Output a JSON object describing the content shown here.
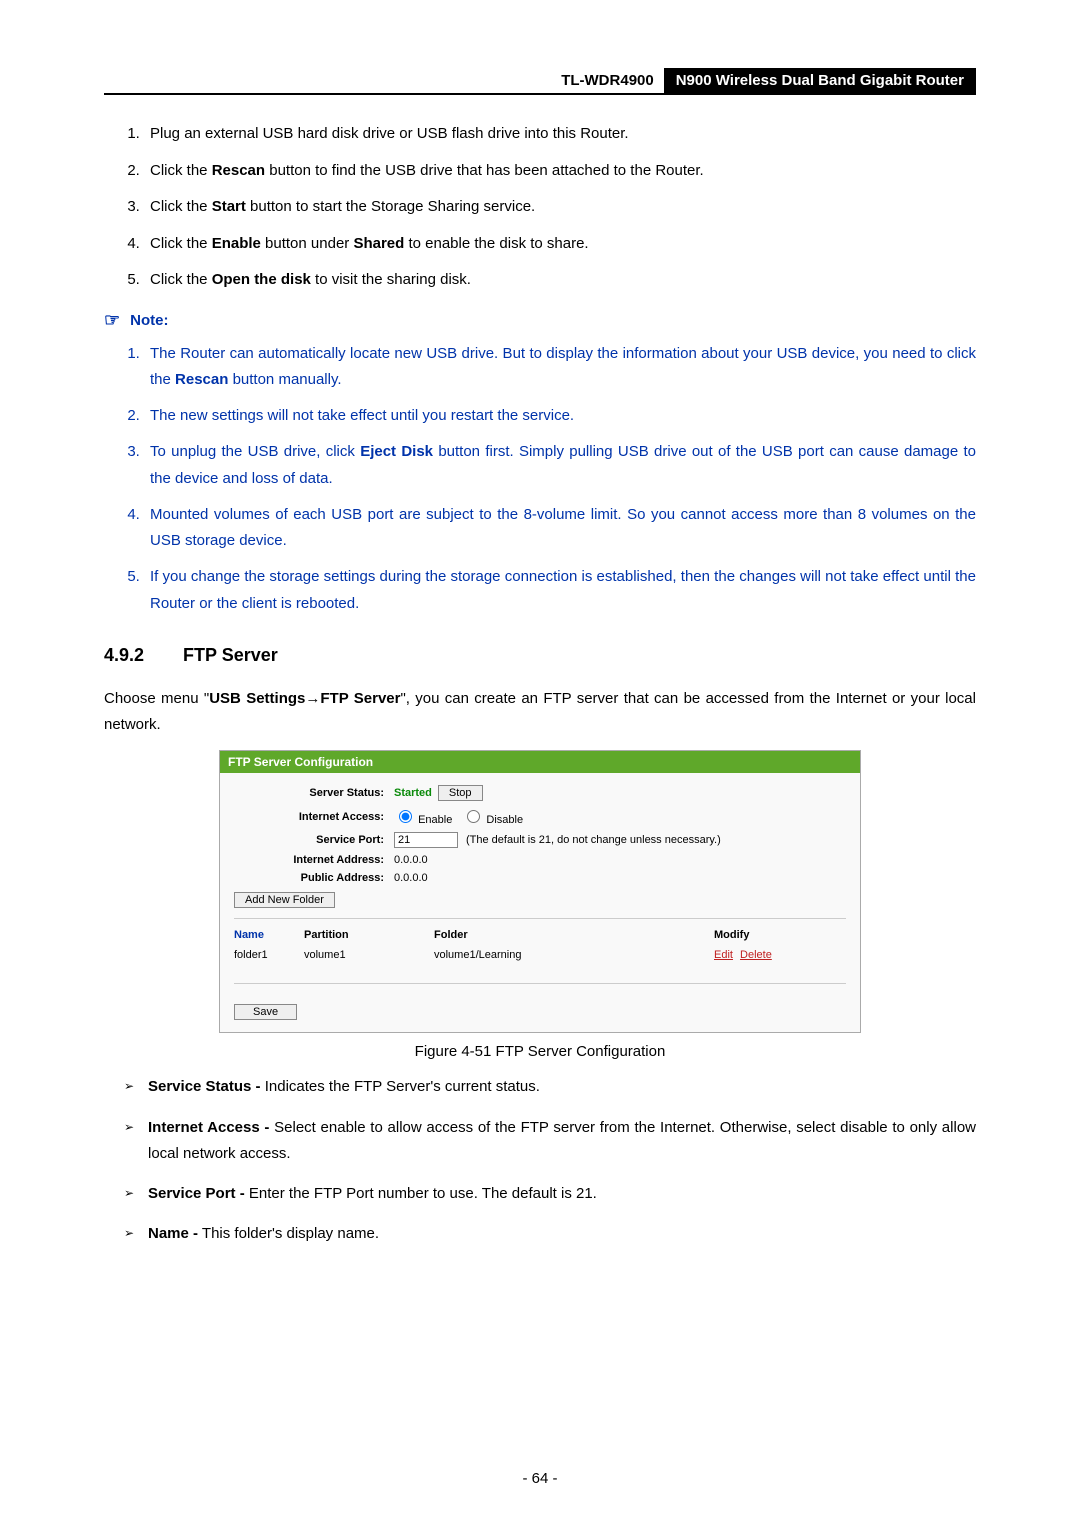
{
  "header": {
    "model": "TL-WDR4900",
    "product": "N900 Wireless Dual Band Gigabit Router"
  },
  "steps": [
    "Plug an external USB hard disk drive or USB flash drive into this Router.",
    "Click the <b>Rescan</b> button to find the USB drive that has been attached to the Router.",
    "Click the <b>Start</b> button to start the Storage Sharing service.",
    "Click the <b>Enable</b> button under <b>Shared</b> to enable the disk to share.",
    "Click the <b>Open the disk</b> to visit the sharing disk."
  ],
  "noteLabel": "Note:",
  "noteItems": [
    "The Router can automatically locate new USB drive. But to display the information about your USB device, you need to click the <b>Rescan</b> button manually.",
    "The new settings will not take effect until you restart the service.",
    "To unplug the USB drive, click <b>Eject Disk</b> button first. Simply pulling USB drive out of the USB port can cause damage to the device and loss of data.",
    "Mounted volumes of each USB port are subject to the 8-volume limit. So you cannot access more than 8 volumes on the USB storage device.",
    "If you change the storage settings during the storage connection is established, then the changes will not take effect until the Router or the client is rebooted."
  ],
  "section": {
    "number": "4.9.2",
    "title": "FTP Server"
  },
  "intro": "Choose menu \"<b>USB Settings</b>→<b>FTP Server</b>\", you can create an FTP server that can be accessed from the Internet or your local network.",
  "ftp": {
    "panelTitle": "FTP Server Configuration",
    "labels": {
      "serverStatus": "Server Status:",
      "internetAccess": "Internet Access:",
      "servicePort": "Service Port:",
      "internetAddress": "Internet Address:",
      "publicAddress": "Public Address:"
    },
    "statusStarted": "Started",
    "stopBtn": "Stop",
    "enableLabel": "Enable",
    "disableLabel": "Disable",
    "servicePortValue": "21",
    "servicePortHint": "(The default is 21, do not change unless necessary.)",
    "internetAddressVal": "0.0.0.0",
    "publicAddressVal": "0.0.0.0",
    "addFolderBtn": "Add New Folder",
    "cols": {
      "name": "Name",
      "partition": "Partition",
      "folder": "Folder",
      "modify": "Modify"
    },
    "row": {
      "name": "folder1",
      "partition": "volume1",
      "folder": "volume1/Learning",
      "edit": "Edit",
      "delete": "Delete"
    },
    "saveBtn": "Save"
  },
  "figCaption": "Figure 4-51 FTP Server Configuration",
  "bullets": [
    "<b>Service Status -</b> Indicates the FTP Server's current status.",
    "<b>Internet Access -</b> Select enable to allow access of the FTP server from the Internet. Otherwise, select disable to only allow local network access.",
    "<b>Service Port -</b> Enter the FTP Port number to use. The default is 21.",
    "<b>Name -</b> This folder's display name."
  ],
  "pageNumber": "- 64 -"
}
